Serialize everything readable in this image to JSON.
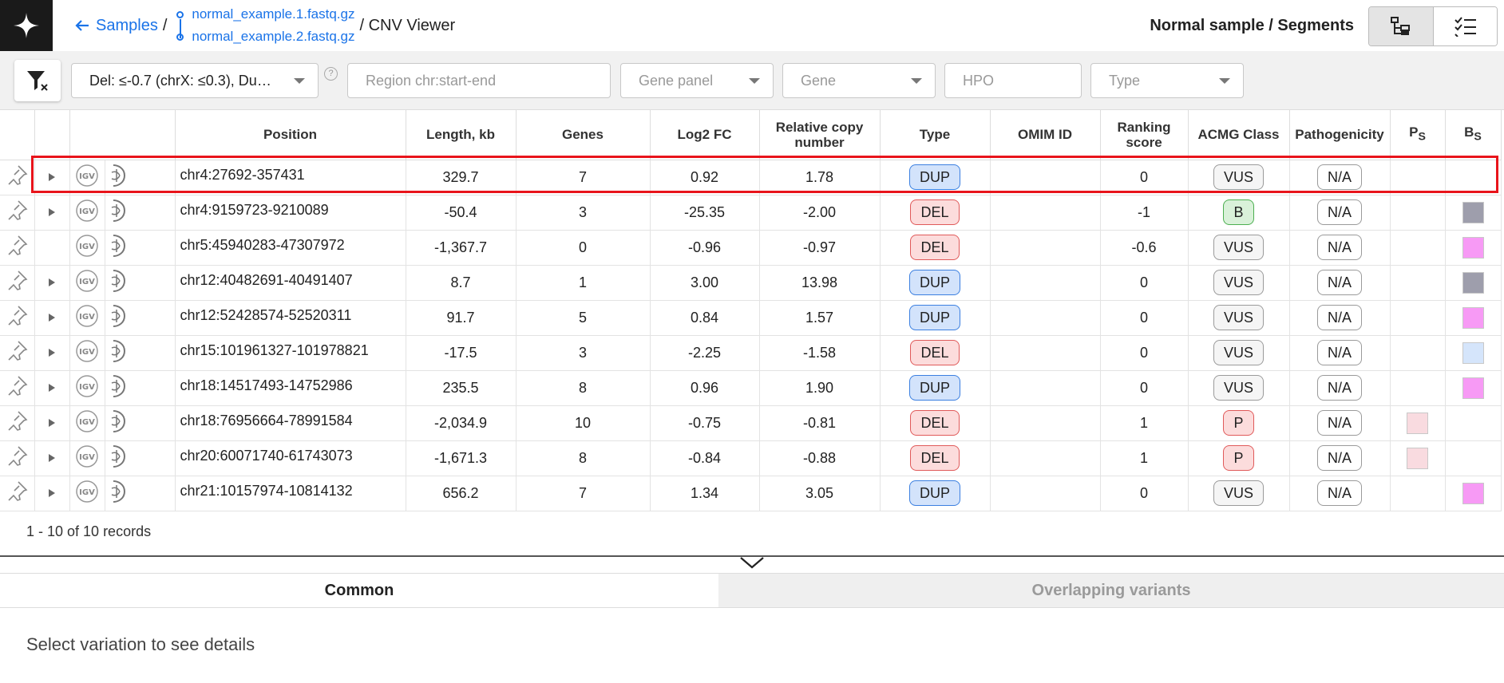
{
  "breadcrumb": {
    "back_label": "Samples",
    "sep1": "/",
    "files": [
      "normal_example.1.fastq.gz",
      "normal_example.2.fastq.gz"
    ],
    "current": "/ CNV Viewer"
  },
  "header": {
    "right_title": "Normal sample / Segments"
  },
  "filters": {
    "cnv_filter_value": "Del: ≤-0.7 (chrX: ≤0.3), Du…",
    "help": "?",
    "region_placeholder": "Region chr:start-end",
    "gene_panel_placeholder": "Gene panel",
    "gene_placeholder": "Gene",
    "hpo_placeholder": "HPO",
    "type_placeholder": "Type"
  },
  "table": {
    "columns": {
      "position": "Position",
      "length": "Length, kb",
      "genes": "Genes",
      "log2fc": "Log2 FC",
      "rel1": "Relative copy",
      "rel2": "number",
      "type": "Type",
      "omim": "OMIM ID",
      "rank1": "Ranking",
      "rank2": "score",
      "acmg": "ACMG Class",
      "path": "Pathogenicity",
      "ps": "P",
      "ps_sub": "S",
      "bs": "B",
      "bs_sub": "S"
    },
    "rows": [
      {
        "expand": true,
        "position": "chr4:27692-357431",
        "length": "329.7",
        "genes": "7",
        "log2fc": "0.92",
        "rel": "1.78",
        "type": "DUP",
        "omim": "",
        "rank": "0",
        "acmg": "VUS",
        "path": "N/A",
        "ps": "",
        "bs": ""
      },
      {
        "expand": true,
        "position": "chr4:9159723-9210089",
        "length": "-50.4",
        "genes": "3",
        "log2fc": "-25.35",
        "rel": "-2.00",
        "type": "DEL",
        "omim": "",
        "rank": "-1",
        "acmg": "B",
        "path": "N/A",
        "ps": "",
        "bs": "#9e9eac"
      },
      {
        "expand": false,
        "position": "chr5:45940283-47307972",
        "length": "-1,367.7",
        "genes": "0",
        "log2fc": "-0.96",
        "rel": "-0.97",
        "type": "DEL",
        "omim": "",
        "rank": "-0.6",
        "acmg": "VUS",
        "path": "N/A",
        "ps": "",
        "bs": "#f79af5"
      },
      {
        "expand": true,
        "position": "chr12:40482691-40491407",
        "length": "8.7",
        "genes": "1",
        "log2fc": "3.00",
        "rel": "13.98",
        "type": "DUP",
        "omim": "",
        "rank": "0",
        "acmg": "VUS",
        "path": "N/A",
        "ps": "",
        "bs": "#9e9eac"
      },
      {
        "expand": true,
        "position": "chr12:52428574-52520311",
        "length": "91.7",
        "genes": "5",
        "log2fc": "0.84",
        "rel": "1.57",
        "type": "DUP",
        "omim": "",
        "rank": "0",
        "acmg": "VUS",
        "path": "N/A",
        "ps": "",
        "bs": "#f79af5"
      },
      {
        "expand": true,
        "position": "chr15:101961327-101978821",
        "length": "-17.5",
        "genes": "3",
        "log2fc": "-2.25",
        "rel": "-1.58",
        "type": "DEL",
        "omim": "",
        "rank": "0",
        "acmg": "VUS",
        "path": "N/A",
        "ps": "",
        "bs": "#d5e5fb"
      },
      {
        "expand": true,
        "position": "chr18:14517493-14752986",
        "length": "235.5",
        "genes": "8",
        "log2fc": "0.96",
        "rel": "1.90",
        "type": "DUP",
        "omim": "",
        "rank": "0",
        "acmg": "VUS",
        "path": "N/A",
        "ps": "",
        "bs": "#f79af5"
      },
      {
        "expand": true,
        "position": "chr18:76956664-78991584",
        "length": "-2,034.9",
        "genes": "10",
        "log2fc": "-0.75",
        "rel": "-0.81",
        "type": "DEL",
        "omim": "",
        "rank": "1",
        "acmg": "P",
        "path": "N/A",
        "ps": "#f9dbe0",
        "bs": ""
      },
      {
        "expand": true,
        "position": "chr20:60071740-61743073",
        "length": "-1,671.3",
        "genes": "8",
        "log2fc": "-0.84",
        "rel": "-0.88",
        "type": "DEL",
        "omim": "",
        "rank": "1",
        "acmg": "P",
        "path": "N/A",
        "ps": "#f9dbe0",
        "bs": ""
      },
      {
        "expand": true,
        "position": "chr21:10157974-10814132",
        "length": "656.2",
        "genes": "7",
        "log2fc": "1.34",
        "rel": "3.05",
        "type": "DUP",
        "omim": "",
        "rank": "0",
        "acmg": "VUS",
        "path": "N/A",
        "ps": "",
        "bs": "#f79af5"
      }
    ]
  },
  "footer": {
    "records": "1 - 10 of 10 records"
  },
  "detail_tabs": {
    "common": "Common",
    "overlapping": "Overlapping variants"
  },
  "details": {
    "empty_message": "Select variation to see details"
  }
}
